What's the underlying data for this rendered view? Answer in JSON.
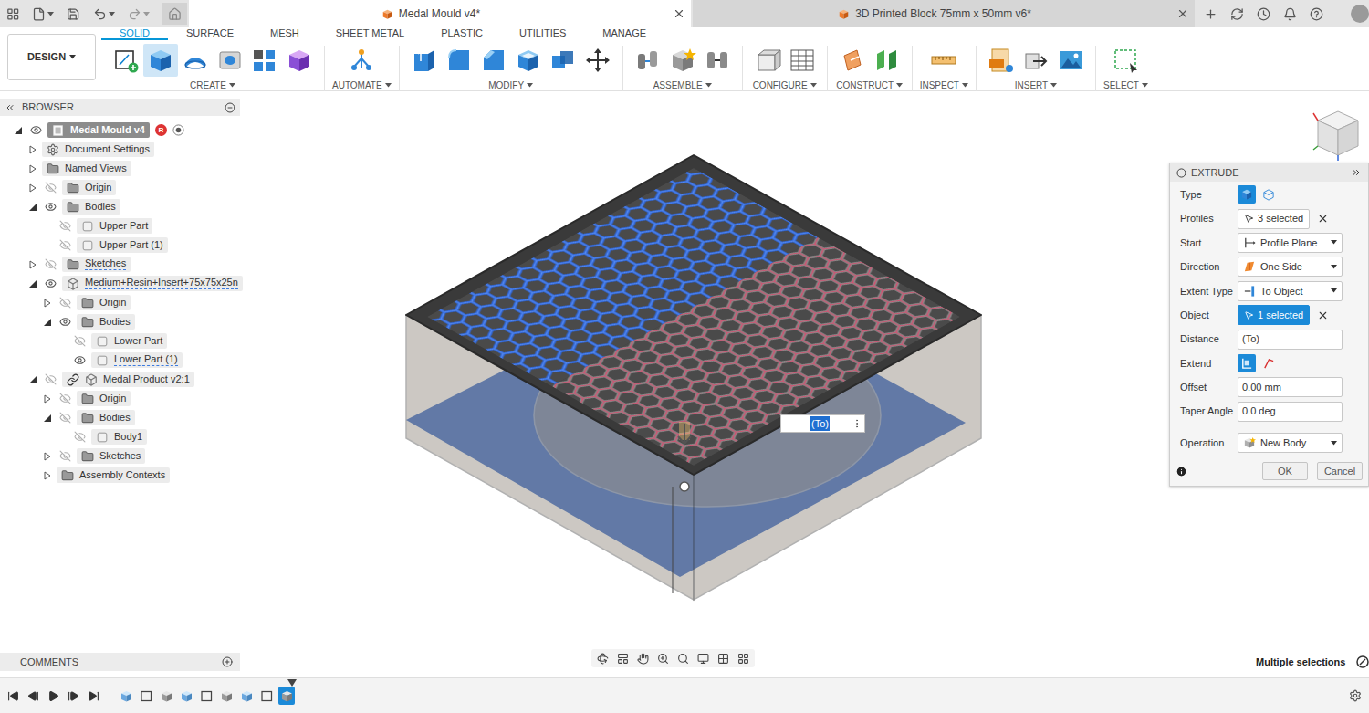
{
  "tabs": [
    {
      "label": "Medal Mould v4*",
      "selected": true
    },
    {
      "label": "3D Printed Block 75mm x 50mm v6*",
      "selected": false
    }
  ],
  "workspace": {
    "label": "DESIGN"
  },
  "ribbon_tabs": [
    {
      "label": "SOLID",
      "selected": true
    },
    {
      "label": "SURFACE",
      "selected": false
    },
    {
      "label": "MESH",
      "selected": false
    },
    {
      "label": "SHEET METAL",
      "selected": false
    },
    {
      "label": "PLASTIC",
      "selected": false
    },
    {
      "label": "UTILITIES",
      "selected": false
    },
    {
      "label": "MANAGE",
      "selected": false
    }
  ],
  "tool_groups": [
    {
      "label": "CREATE",
      "tools": [
        {
          "selected": false
        },
        {
          "selected": true
        },
        {
          "selected": false
        },
        {
          "selected": false
        },
        {
          "selected": false
        },
        {
          "selected": false
        }
      ]
    },
    {
      "label": "AUTOMATE",
      "tools": [
        {
          "selected": false
        }
      ]
    },
    {
      "label": "MODIFY",
      "tools": [
        {
          "selected": false
        },
        {
          "selected": false
        },
        {
          "selected": false
        },
        {
          "selected": false
        },
        {
          "selected": false
        },
        {
          "selected": false
        }
      ]
    },
    {
      "label": "ASSEMBLE",
      "tools": [
        {
          "selected": false
        },
        {
          "selected": false
        },
        {
          "selected": false
        }
      ]
    },
    {
      "label": "CONFIGURE",
      "tools": [
        {
          "selected": false
        },
        {
          "selected": false
        }
      ]
    },
    {
      "label": "CONSTRUCT",
      "tools": [
        {
          "selected": false
        },
        {
          "selected": false
        }
      ]
    },
    {
      "label": "INSPECT",
      "tools": [
        {
          "selected": false
        }
      ]
    },
    {
      "label": "INSERT",
      "tools": [
        {
          "selected": false
        },
        {
          "selected": false
        },
        {
          "selected": false
        }
      ]
    },
    {
      "label": "SELECT",
      "tools": [
        {
          "selected": false
        }
      ]
    }
  ],
  "browser": {
    "title": "BROWSER",
    "tree": [
      {
        "label": "Medal Mould v4",
        "kind": "root",
        "expandable": true,
        "expanded": true,
        "eye": true,
        "visible": true,
        "selected": true,
        "flagged": false,
        "badge": "R",
        "children": [
          {
            "label": "Document Settings",
            "kind": "settings",
            "expandable": true,
            "expanded": false,
            "eye": false,
            "visible": true,
            "selected": false,
            "flagged": false,
            "badge": "",
            "children": []
          },
          {
            "label": "Named Views",
            "kind": "folder",
            "expandable": true,
            "expanded": false,
            "eye": false,
            "visible": true,
            "selected": false,
            "flagged": false,
            "badge": "",
            "children": []
          },
          {
            "label": "Origin",
            "kind": "folder",
            "expandable": true,
            "expanded": false,
            "eye": true,
            "visible": false,
            "selected": false,
            "flagged": false,
            "badge": "",
            "children": []
          },
          {
            "label": "Bodies",
            "kind": "folder",
            "expandable": true,
            "expanded": true,
            "eye": true,
            "visible": true,
            "selected": false,
            "flagged": false,
            "badge": "",
            "children": [
              {
                "label": "Upper Part",
                "kind": "body",
                "expandable": false,
                "expanded": false,
                "eye": true,
                "visible": false,
                "selected": false,
                "flagged": false,
                "badge": "",
                "children": []
              },
              {
                "label": "Upper Part (1)",
                "kind": "body",
                "expandable": false,
                "expanded": false,
                "eye": true,
                "visible": false,
                "selected": false,
                "flagged": false,
                "badge": "",
                "children": []
              }
            ]
          },
          {
            "label": "Sketches",
            "kind": "folder",
            "expandable": true,
            "expanded": false,
            "eye": true,
            "visible": false,
            "selected": false,
            "flagged": true,
            "badge": "",
            "children": []
          },
          {
            "label": "Medium+Resin+Insert+75x75x25n",
            "kind": "component",
            "expandable": true,
            "expanded": true,
            "eye": true,
            "visible": true,
            "selected": false,
            "flagged": true,
            "badge": "",
            "children": [
              {
                "label": "Origin",
                "kind": "folder",
                "expandable": true,
                "expanded": false,
                "eye": true,
                "visible": false,
                "selected": false,
                "flagged": false,
                "badge": "",
                "children": []
              },
              {
                "label": "Bodies",
                "kind": "folder",
                "expandable": true,
                "expanded": true,
                "eye": true,
                "visible": true,
                "selected": false,
                "flagged": false,
                "badge": "",
                "children": [
                  {
                    "label": "Lower Part",
                    "kind": "body",
                    "expandable": false,
                    "expanded": false,
                    "eye": true,
                    "visible": false,
                    "selected": false,
                    "flagged": false,
                    "badge": "",
                    "children": []
                  },
                  {
                    "label": "Lower Part (1)",
                    "kind": "body",
                    "expandable": false,
                    "expanded": false,
                    "eye": true,
                    "visible": true,
                    "selected": false,
                    "flagged": true,
                    "badge": "",
                    "children": []
                  }
                ]
              }
            ]
          },
          {
            "label": "Medal Product v2:1",
            "kind": "linked",
            "expandable": true,
            "expanded": true,
            "eye": true,
            "visible": false,
            "selected": false,
            "flagged": false,
            "badge": "",
            "children": [
              {
                "label": "Origin",
                "kind": "folder",
                "expandable": true,
                "expanded": false,
                "eye": true,
                "visible": false,
                "selected": false,
                "flagged": false,
                "badge": "",
                "children": []
              },
              {
                "label": "Bodies",
                "kind": "folder",
                "expandable": true,
                "expanded": true,
                "eye": true,
                "visible": false,
                "selected": false,
                "flagged": false,
                "badge": "",
                "children": [
                  {
                    "label": "Body1",
                    "kind": "body",
                    "expandable": false,
                    "expanded": false,
                    "eye": true,
                    "visible": false,
                    "selected": false,
                    "flagged": false,
                    "badge": "",
                    "children": []
                  }
                ]
              },
              {
                "label": "Sketches",
                "kind": "folder",
                "expandable": true,
                "expanded": false,
                "eye": true,
                "visible": false,
                "selected": false,
                "flagged": false,
                "badge": "",
                "children": []
              },
              {
                "label": "Assembly Contexts",
                "kind": "folder",
                "expandable": true,
                "expanded": false,
                "eye": false,
                "visible": true,
                "selected": false,
                "flagged": false,
                "badge": "",
                "children": []
              }
            ]
          }
        ]
      }
    ]
  },
  "comments": {
    "title": "COMMENTS"
  },
  "canvas_input": {
    "value": "(To)",
    "selected": true
  },
  "extrude": {
    "title": "EXTRUDE",
    "rows": [
      {
        "label": "Type",
        "kind": "toggle",
        "value": "",
        "active": false,
        "options": [
          {
            "selected": true
          },
          {
            "selected": false
          }
        ]
      },
      {
        "label": "Profiles",
        "kind": "selection",
        "value": "3 selected",
        "active": false,
        "options": []
      },
      {
        "label": "Start",
        "kind": "dropdown",
        "value": "Profile Plane",
        "active": false,
        "options": []
      },
      {
        "label": "Direction",
        "kind": "dropdown",
        "value": "One Side",
        "active": false,
        "options": []
      },
      {
        "label": "Extent Type",
        "kind": "dropdown",
        "value": "To Object",
        "active": false,
        "options": []
      },
      {
        "label": "Object",
        "kind": "selection",
        "value": "1 selected",
        "active": true,
        "options": []
      },
      {
        "label": "Distance",
        "kind": "input",
        "value": "(To)",
        "active": false,
        "options": []
      },
      {
        "label": "Extend",
        "kind": "toggle",
        "value": "",
        "active": false,
        "options": [
          {
            "selected": true
          },
          {
            "selected": false
          }
        ]
      },
      {
        "label": "Offset",
        "kind": "input",
        "value": "0.00 mm",
        "active": false,
        "options": []
      },
      {
        "label": "Taper Angle",
        "kind": "input",
        "value": "0.0 deg",
        "active": false,
        "options": []
      }
    ],
    "operation": {
      "label": "Operation",
      "kind": "dropdown",
      "value": "New Body",
      "active": false,
      "options": []
    },
    "buttons": [
      {
        "label": "OK"
      },
      {
        "label": "Cancel"
      }
    ]
  },
  "status": {
    "text": "Multiple selections"
  },
  "timeline": {
    "features": [
      {
        "selected": false
      },
      {
        "selected": false
      },
      {
        "selected": false
      },
      {
        "selected": false
      },
      {
        "selected": false
      },
      {
        "selected": false
      },
      {
        "selected": false
      },
      {
        "selected": false
      },
      {
        "selected": true
      }
    ]
  }
}
